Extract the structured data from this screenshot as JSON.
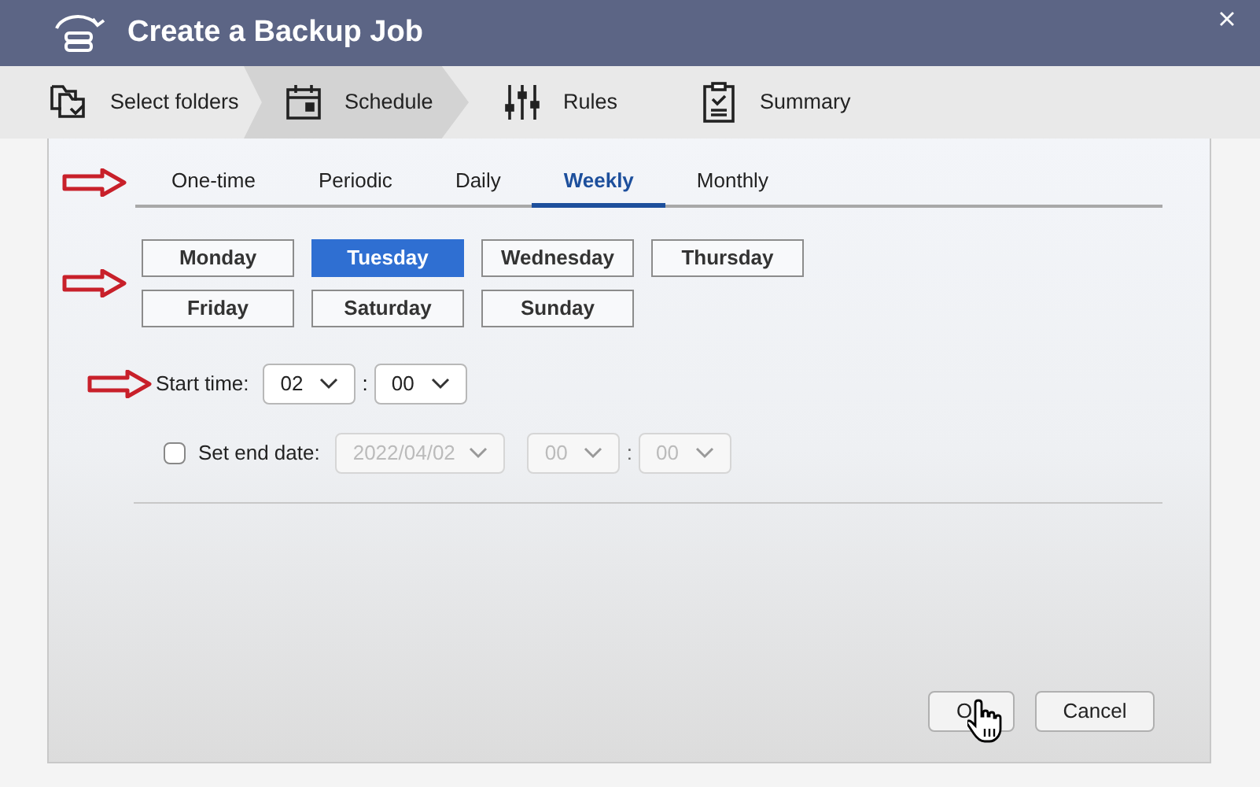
{
  "window": {
    "title": "Create a Backup Job"
  },
  "steps": [
    {
      "label": "Select folders",
      "kind": "folders",
      "selected": false
    },
    {
      "label": "Schedule",
      "kind": "calendar",
      "selected": true
    },
    {
      "label": "Rules",
      "kind": "sliders",
      "selected": false
    },
    {
      "label": "Summary",
      "kind": "clipboard",
      "selected": false
    }
  ],
  "tabs": [
    {
      "label": "One-time",
      "selected": false
    },
    {
      "label": "Periodic",
      "selected": false
    },
    {
      "label": "Daily",
      "selected": false
    },
    {
      "label": "Weekly",
      "selected": true
    },
    {
      "label": "Monthly",
      "selected": false
    }
  ],
  "days": [
    {
      "label": "Monday",
      "selected": false
    },
    {
      "label": "Tuesday",
      "selected": true
    },
    {
      "label": "Wednesday",
      "selected": false
    },
    {
      "label": "Thursday",
      "selected": false
    },
    {
      "label": "Friday",
      "selected": false
    },
    {
      "label": "Saturday",
      "selected": false
    },
    {
      "label": "Sunday",
      "selected": false
    }
  ],
  "start_time": {
    "label": "Start time:",
    "hour": "02",
    "separator": ":",
    "minute": "00"
  },
  "end_date": {
    "label": "Set end date:",
    "checked": false,
    "disabled": true,
    "date": "2022/04/02",
    "hour": "00",
    "separator": ":",
    "minute": "00"
  },
  "buttons": [
    {
      "label": "O"
    },
    {
      "label": "Cancel"
    }
  ]
}
